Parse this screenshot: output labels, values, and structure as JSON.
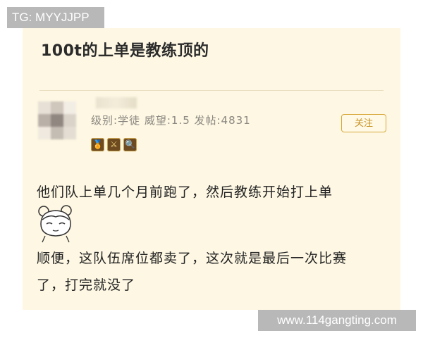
{
  "watermarks": {
    "top_left": "TG: MYYJJPP",
    "bottom_right": "www.114gangting.com"
  },
  "post": {
    "title": "100t的上单是教练顶的"
  },
  "author": {
    "meta": "级别:学徒 威望:1.5 发帖:4831",
    "badges": [
      "🏅",
      "⚔",
      "🔍"
    ]
  },
  "actions": {
    "follow_label": "关注"
  },
  "content": {
    "line1": "他们队上单几个月前跑了，然后教练开始打上单",
    "line2": "顺便，这队伍席位都卖了，这次就是最后一次比赛",
    "line3": "了，打完就没了"
  },
  "colors": {
    "card_background": "#fdf7e3",
    "follow_accent": "#d8a93a",
    "watermark_background": "#b8b8b8"
  }
}
